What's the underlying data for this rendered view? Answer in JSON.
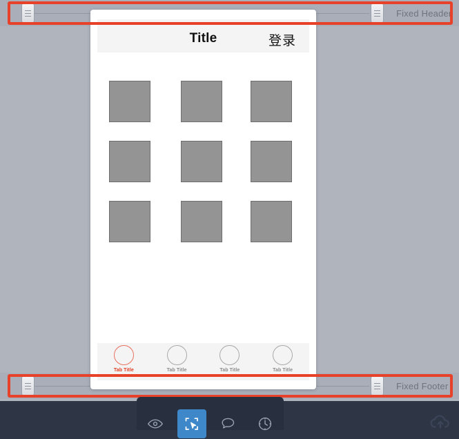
{
  "canvas": {
    "background_color": "#b0b4bd",
    "selection_color": "#e8412a"
  },
  "header_band": {
    "label": "Fixed Header",
    "handle_left_icon": "drag-handle-icon",
    "handle_right_icon": "drag-handle-icon",
    "selected": true
  },
  "footer_band": {
    "label": "Fixed Footer",
    "handle_left_icon": "drag-handle-icon",
    "handle_right_icon": "drag-handle-icon",
    "selected": true
  },
  "phone": {
    "navbar": {
      "title": "Title",
      "action_label": "登录"
    },
    "grid": {
      "rows": [
        {
          "cells": [
            "image-placeholder",
            "image-placeholder",
            "image-placeholder"
          ]
        },
        {
          "cells": [
            "image-placeholder",
            "image-placeholder",
            "image-placeholder"
          ]
        },
        {
          "cells": [
            "image-placeholder",
            "image-placeholder",
            "image-placeholder"
          ]
        }
      ]
    },
    "tabbar": {
      "tabs": [
        {
          "label": "Tab Title",
          "active": true,
          "icon": "circle-icon"
        },
        {
          "label": "Tab Title",
          "active": false,
          "icon": "circle-icon"
        },
        {
          "label": "Tab Title",
          "active": false,
          "icon": "circle-icon"
        },
        {
          "label": "Tab Title",
          "active": false,
          "icon": "circle-icon"
        }
      ],
      "active_color": "#e23c22",
      "inactive_color": "#8a8a8a"
    }
  },
  "toolbar": {
    "background_color": "#283040",
    "active_color": "#3e88ca",
    "tools": [
      {
        "name": "preview-eye",
        "icon": "eye-icon",
        "active": false
      },
      {
        "name": "select",
        "icon": "selection-cursor-icon",
        "active": true
      },
      {
        "name": "comment",
        "icon": "comment-bubble-icon",
        "active": false
      },
      {
        "name": "history",
        "icon": "clock-history-icon",
        "active": false
      }
    ],
    "cloud": {
      "name": "upload",
      "icon": "cloud-upload-icon"
    }
  }
}
